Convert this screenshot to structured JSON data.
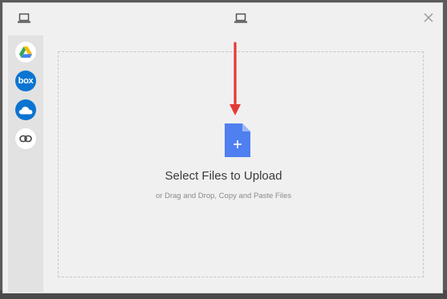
{
  "header": {
    "left_icon": "laptop-icon",
    "center_icon": "laptop-icon",
    "close_icon": "close-icon"
  },
  "sidebar": {
    "sources": [
      {
        "id": "google-drive",
        "icon": "google-drive-icon"
      },
      {
        "id": "box",
        "label": "box",
        "icon": "box-icon"
      },
      {
        "id": "onedrive",
        "icon": "onedrive-icon"
      },
      {
        "id": "link",
        "icon": "link-icon"
      }
    ]
  },
  "dropzone": {
    "title": "Select Files to Upload",
    "subtitle": "or Drag and Drop, Copy and Paste Files",
    "file_icon": "file-add-icon",
    "arrow_icon": "down-arrow-icon"
  },
  "colors": {
    "accent_blue": "#4285f4",
    "arrow_red": "#e53935",
    "service_blue": "#0b74d1"
  }
}
